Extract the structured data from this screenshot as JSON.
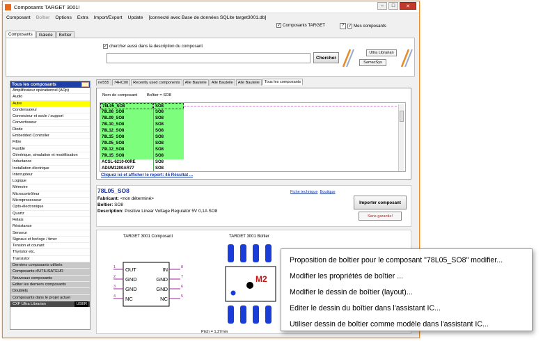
{
  "window": {
    "title": "Composants TARGET 3001!",
    "controls": {
      "minimize": "–",
      "maximize": "□",
      "close": "✕"
    }
  },
  "menu": [
    {
      "label": "Composant",
      "enabled": true
    },
    {
      "label": "Boîtier",
      "enabled": false
    },
    {
      "label": "Options",
      "enabled": true
    },
    {
      "label": "Extra",
      "enabled": true
    },
    {
      "label": "Import/Export",
      "enabled": true
    },
    {
      "label": "Update",
      "enabled": true
    },
    {
      "label": "[connecté avec Base de données SQLite target3001.db]",
      "enabled": true
    }
  ],
  "top_checks": {
    "composants_target": {
      "label": "Composants TARGET",
      "checked": true
    },
    "help": "?",
    "mes_composants": {
      "label": "Mes composants",
      "checked": true
    }
  },
  "main_tabs": [
    {
      "label": "Composants",
      "active": true
    },
    {
      "label": "Galerie",
      "active": false
    },
    {
      "label": "Boîtier",
      "active": false
    }
  ],
  "search": {
    "desc_check": {
      "label": "chercher aussi dans la description du composant",
      "checked": true
    },
    "value": "",
    "button": "Chercher",
    "ultra_librarian": "Ultra Librarian",
    "samacsys": "SamacSys"
  },
  "categories": {
    "header": "Tous les composants",
    "items": [
      {
        "label": "Amplificateur opérationnel (AOp)",
        "style": ""
      },
      {
        "label": "Audio",
        "style": ""
      },
      {
        "label": "Autre",
        "style": "sel"
      },
      {
        "label": "Condensateur",
        "style": ""
      },
      {
        "label": "Connecteur et socle / support",
        "style": ""
      },
      {
        "label": "Convertisseur",
        "style": ""
      },
      {
        "label": "Diode",
        "style": ""
      },
      {
        "label": "Embedded Controller",
        "style": ""
      },
      {
        "label": "Filtre",
        "style": ""
      },
      {
        "label": "Fusible",
        "style": ""
      },
      {
        "label": "Générique, simulation et modélisation",
        "style": ""
      },
      {
        "label": "Inductance",
        "style": ""
      },
      {
        "label": "Installation électrique",
        "style": ""
      },
      {
        "label": "Interrupteur",
        "style": ""
      },
      {
        "label": "Logique",
        "style": ""
      },
      {
        "label": "Mémoire",
        "style": ""
      },
      {
        "label": "Microcontrôleur",
        "style": ""
      },
      {
        "label": "Microprocesseur",
        "style": ""
      },
      {
        "label": "Opto-électronique",
        "style": ""
      },
      {
        "label": "Quartz",
        "style": ""
      },
      {
        "label": "Relais",
        "style": ""
      },
      {
        "label": "Résistance",
        "style": ""
      },
      {
        "label": "Senseur",
        "style": ""
      },
      {
        "label": "Signaux et horloge / timer",
        "style": ""
      },
      {
        "label": "Tension et courant",
        "style": ""
      },
      {
        "label": "Thyristor etc.",
        "style": ""
      },
      {
        "label": "Transistor",
        "style": ""
      },
      {
        "label": "Derniers composants utilisés",
        "style": "grey"
      },
      {
        "label": "Composants d'UTILISATEUR",
        "style": "grey"
      },
      {
        "label": "Nouveaux composants",
        "style": "grey"
      },
      {
        "label": "Editer les derniers composants",
        "style": "grey"
      },
      {
        "label": "Doublets",
        "style": "grey"
      },
      {
        "label": "Composants dans le projet actuel",
        "style": "grey"
      }
    ],
    "footer": {
      "label": "CXF Ultra Librarian",
      "badge": "USER"
    }
  },
  "result_tabs": [
    "ne555",
    "74HC00",
    "Recently used components",
    "Alle Bauteile",
    "Alle Bauteile",
    "Alle Bauteile",
    "Tous les composants"
  ],
  "results": {
    "col_name": "Nom de composant",
    "col_package": "Boîtier = SO8",
    "rows": [
      {
        "name": "78L05_SO8",
        "pkg": "SO8",
        "selected": true,
        "green": true
      },
      {
        "name": "78L08_SO8",
        "pkg": "SO8",
        "selected": false,
        "green": true
      },
      {
        "name": "78L09_SO8",
        "pkg": "SO8",
        "selected": false,
        "green": true
      },
      {
        "name": "78L10_SO8",
        "pkg": "SO8",
        "selected": false,
        "green": true
      },
      {
        "name": "78L12_SO8",
        "pkg": "SO8",
        "selected": false,
        "green": true
      },
      {
        "name": "78L15_SO8",
        "pkg": "SO8",
        "selected": false,
        "green": true
      },
      {
        "name": "79L05_SO8",
        "pkg": "SO8",
        "selected": false,
        "green": true
      },
      {
        "name": "79L12_SO8",
        "pkg": "SO8",
        "selected": false,
        "green": true
      },
      {
        "name": "79L15_SO8",
        "pkg": "SO8",
        "selected": false,
        "green": true
      },
      {
        "name": "ACSL-6210-00RE",
        "pkg": "SO8",
        "selected": false,
        "green": false
      },
      {
        "name": "ADUM1200AR77",
        "pkg": "SO8",
        "selected": false,
        "green": false
      }
    ],
    "report_link": "Cliquez ici et afficher le report: 45 Résultat ..."
  },
  "detail": {
    "title": "78L05_SO8",
    "fabricant_label": "Fabricant:",
    "fabricant": "<non déterminé>",
    "boitier_label": "Boîtier:",
    "boitier": "SO8",
    "description_label": "Description:",
    "description": "Positive Linear Voltage Regulator 5V 0,1A SO8",
    "links": [
      "Fiche technique",
      "Boutique"
    ],
    "import_button": "Importer composant",
    "sans_garantie": "Sans garantie!"
  },
  "preview": {
    "schematic_title": "TARGET 3001 Composant",
    "package_title": "TARGET 3001 Boîtier",
    "pins_left": [
      {
        "num": "1",
        "label": "OUT"
      },
      {
        "num": "2",
        "label": "GND"
      },
      {
        "num": "3",
        "label": "GND"
      },
      {
        "num": "4",
        "label": "NC"
      }
    ],
    "pins_right": [
      {
        "num": "8",
        "label": "IN"
      },
      {
        "num": "7",
        "label": "GND"
      },
      {
        "num": "6",
        "label": "GND"
      },
      {
        "num": "5",
        "label": "NC"
      }
    ],
    "package_marker": "M2",
    "pitch": "Pitch = 1,27mm"
  },
  "context_menu": [
    "Proposition de boîtier pour le composant \"78L05_SO8\" modifier...",
    "Modifier les propriétés de boîtier ...",
    "Modifier le dessin de boîtier (layout)...",
    "Editer le dessin du boîtier dans l'assistant IC...",
    "Utiliser dessin de boîtier comme modèle dans l'assistant IC..."
  ],
  "colors": {
    "accent": "#e88a2a",
    "category_header": "#1e3fa8",
    "selected_category": "#ffff00",
    "result_green": "#7dff7d",
    "link": "#1a3aa8",
    "pad_blue": "#1a3cd8",
    "marker_red": "#cc1111",
    "pin_magenta": "#a020a0"
  }
}
